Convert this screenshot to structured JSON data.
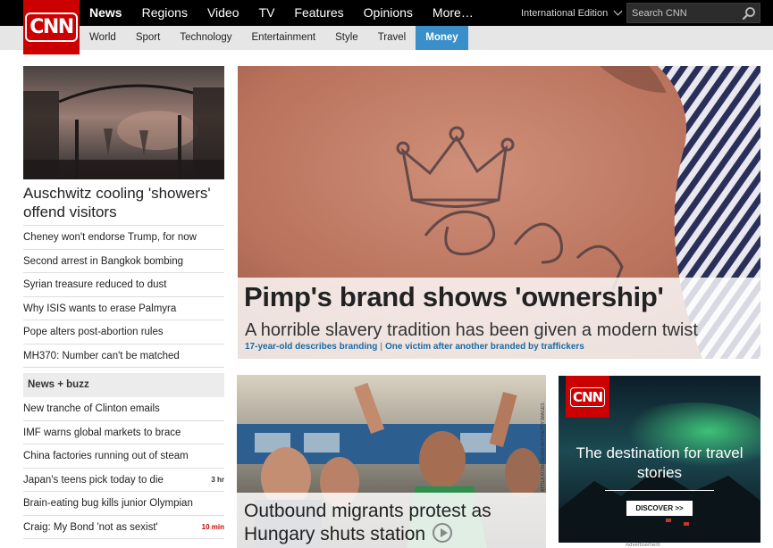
{
  "header": {
    "logo_text": "CNN",
    "main_nav": [
      "News",
      "Regions",
      "Video",
      "TV",
      "Features",
      "Opinions",
      "More…"
    ],
    "edition_label": "International Edition",
    "search_placeholder": "Search CNN",
    "sub_nav": [
      "World",
      "Sport",
      "Technology",
      "Entertainment",
      "Style",
      "Travel",
      "Money"
    ],
    "active_sub_nav": "Money",
    "brand_color": "#cc0000",
    "active_tab_color": "#3a8fc8"
  },
  "left_column": {
    "lead_headline": "Auschwitz cooling 'showers' offend visitors",
    "stories": [
      "Cheney won't endorse Trump, for now",
      "Second arrest in Bangkok bombing",
      "Syrian treasure reduced to dust",
      "Why ISIS wants to erase Palmyra",
      "Pope alters post-abortion rules",
      "MH370: Number can't be matched"
    ],
    "buzz_section_title": "News + buzz",
    "buzz_stories": [
      {
        "text": "New tranche of Clinton emails",
        "stamp": ""
      },
      {
        "text": "IMF warns global markets to brace",
        "stamp": ""
      },
      {
        "text": "China factories running out of steam",
        "stamp": ""
      },
      {
        "text": "Japan's teens pick today to die",
        "stamp": "3 hr"
      },
      {
        "text": "Brain-eating bug kills junior Olympian",
        "stamp": ""
      },
      {
        "text": "Craig: My Bond 'not as sexist'",
        "stamp": "10 min"
      }
    ]
  },
  "hero": {
    "title": "Pimp's brand shows 'ownership'",
    "subtitle": "A horrible slavery tradition has been given a modern twist",
    "links": [
      "17-year-old describes branding",
      "One victim after another branded by traffickers"
    ]
  },
  "second_story": {
    "title": "Outbound migrants protest as Hungary shuts station",
    "photo_credit": "ATTILA KISBENEDEK/AFP/GETTY IMAGES"
  },
  "ad": {
    "logo_text": "CNN",
    "tagline": "The destination for travel stories",
    "button_label": "DISCOVER >>",
    "label": "Advertisement"
  }
}
